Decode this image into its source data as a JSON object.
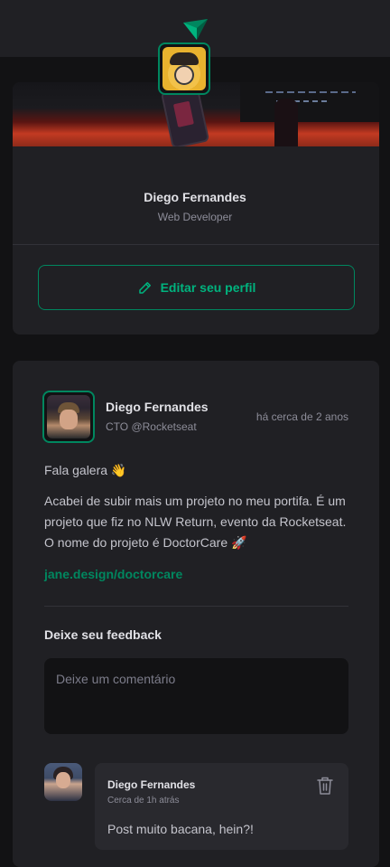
{
  "profile": {
    "name": "Diego Fernandes",
    "role": "Web Developer",
    "edit_label": "Editar seu perfil"
  },
  "post": {
    "author": "Diego Fernandes",
    "role": "CTO @Rocketseat",
    "time": "há cerca de 2 anos",
    "greeting": "Fala galera 👋",
    "body": "Acabei de subir mais um projeto no meu portifa. É um projeto que fiz no NLW Return, evento da Rocketseat. O nome do projeto é DoctorCare 🚀",
    "link": "jane.design/doctorcare"
  },
  "feedback": {
    "title": "Deixe seu feedback",
    "placeholder": "Deixe um comentário"
  },
  "comment": {
    "author": "Diego Fernandes",
    "time": "Cerca de 1h atrás",
    "text": "Post muito bacana, hein?!"
  },
  "colors": {
    "accent": "#00875f",
    "accent_light": "#00b37e",
    "background": "#121214",
    "card": "#202024"
  }
}
